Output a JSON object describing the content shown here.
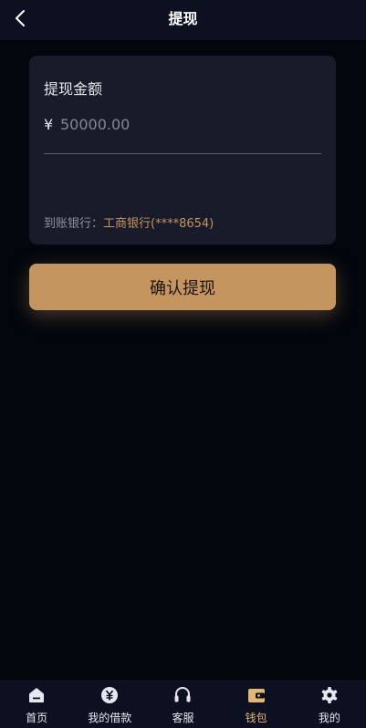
{
  "header": {
    "title": "提现",
    "back_icon": "chevron-left-icon"
  },
  "form": {
    "amount_label": "提现金额",
    "currency_symbol": "¥",
    "amount_placeholder": "50000.00",
    "bank_label": "到账银行：",
    "bank_value": "工商银行(****8654)"
  },
  "confirm_button": {
    "label": "确认提现"
  },
  "tabbar": {
    "items": [
      {
        "label": "首页",
        "icon": "home-icon"
      },
      {
        "label": "我的借款",
        "icon": "yen-coin-icon"
      },
      {
        "label": "客服",
        "icon": "headset-icon"
      },
      {
        "label": "钱包",
        "icon": "wallet-icon",
        "active": true
      },
      {
        "label": "我的",
        "icon": "gear-icon"
      }
    ]
  },
  "colors": {
    "background": "#03060d",
    "header": "#0c1020",
    "card": "#181c2a",
    "accent": "#c4955f",
    "active_tab": "#e2b773",
    "bank_value": "#c9925c"
  }
}
